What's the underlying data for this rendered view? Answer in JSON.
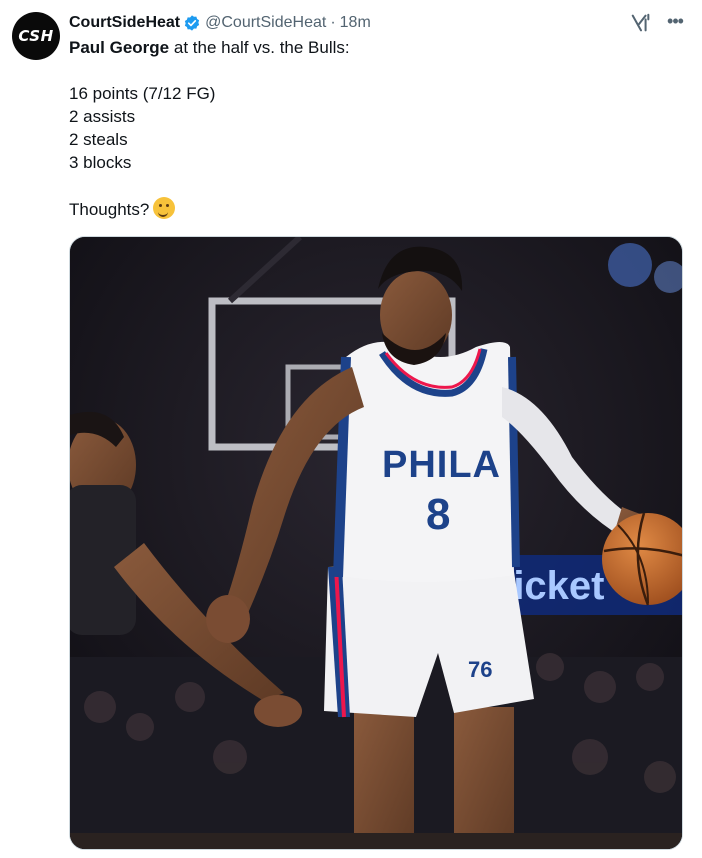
{
  "account": {
    "avatar_text": "CSH",
    "display_name": "CourtSideHeat",
    "handle": "@CourtSideHeat",
    "separator": "·",
    "timestamp": "18m",
    "verified": true
  },
  "tweet": {
    "headline_bold": "Paul George",
    "headline_rest": " at the half vs. the Bulls:",
    "stats": [
      "16 points (7/12 FG)",
      "2 assists",
      "2 steals",
      "3 blocks"
    ],
    "closing": "Thoughts?",
    "emoji": "thinking-face-emoji"
  },
  "media": {
    "jersey_text": "PHILA",
    "jersey_number": "8",
    "shorts_logo": "76",
    "arena_sign": "ticket"
  },
  "icons": {
    "verified": "verified-badge-icon",
    "grok": "grok-icon",
    "more": "more-options-icon"
  },
  "colors": {
    "text_primary": "#0f1419",
    "text_secondary": "#536471",
    "verified_blue": "#1d9bf0",
    "border": "#cfd9de",
    "sixers_blue": "#1d428a",
    "sixers_red": "#ed174c"
  }
}
